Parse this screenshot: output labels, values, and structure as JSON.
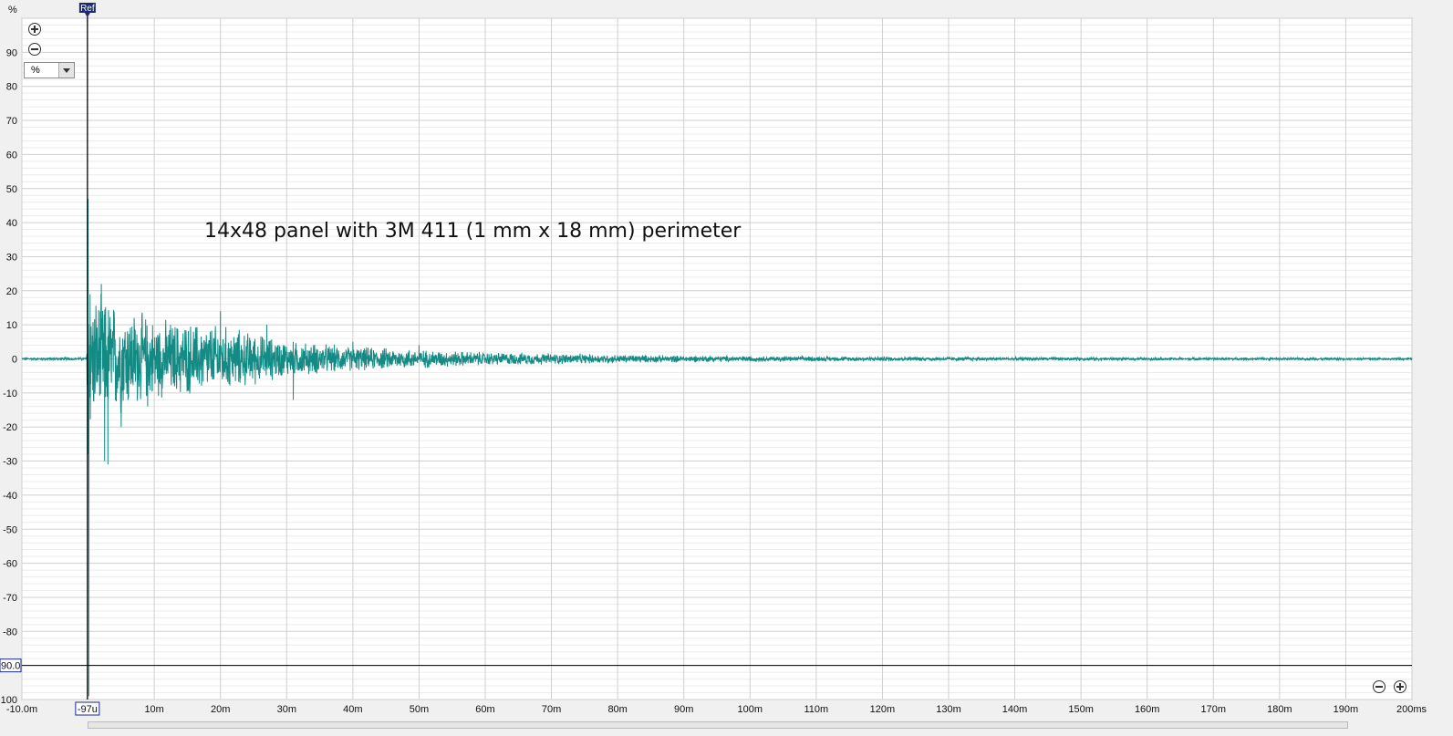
{
  "chart_data": {
    "type": "line",
    "y_unit_label": "%",
    "x_unit": "s",
    "xlim": [
      -0.01,
      0.2
    ],
    "ylim": [
      -100,
      100
    ],
    "x_tick_labels": [
      "-10.0m",
      "10m",
      "20m",
      "30m",
      "40m",
      "50m",
      "60m",
      "70m",
      "80m",
      "90m",
      "100m",
      "110m",
      "120m",
      "130m",
      "140m",
      "150m",
      "160m",
      "170m",
      "180m",
      "190m",
      "200ms"
    ],
    "x_tick_values": [
      -0.01,
      0.01,
      0.02,
      0.03,
      0.04,
      0.05,
      0.06,
      0.07,
      0.08,
      0.09,
      0.1,
      0.11,
      0.12,
      0.13,
      0.14,
      0.15,
      0.16,
      0.17,
      0.18,
      0.19,
      0.2
    ],
    "y_tick_values": [
      90,
      80,
      70,
      60,
      50,
      40,
      30,
      20,
      10,
      0,
      -10,
      -20,
      -30,
      -40,
      -50,
      -60,
      -70,
      -80,
      -100
    ],
    "annotation": "14x48 panel with 3M 411 (1 mm x 18 mm) perimeter",
    "reference_marker": {
      "label": "Ref",
      "x": -9.7e-05,
      "x_label": "-97u"
    },
    "level_marker": {
      "y": -90,
      "label": "90.0"
    },
    "grid": true,
    "series": [
      {
        "color": "#148a84",
        "envelope_x": [
          -0.01,
          -0.0002,
          0,
          0.0002,
          0.0005,
          0.002,
          0.005,
          0.01,
          0.02,
          0.03,
          0.04,
          0.05,
          0.06,
          0.07,
          0.08,
          0.09,
          0.1,
          0.12,
          0.14,
          0.16,
          0.18,
          0.2
        ],
        "envelope_y": [
          0.4,
          0.5,
          47,
          -28,
          20,
          20,
          18,
          13,
          11,
          6,
          4,
          3,
          2.2,
          1.8,
          1.4,
          1.1,
          0.9,
          0.7,
          0.55,
          0.45,
          0.4,
          0.35
        ],
        "peaks": [
          [
            0,
            47
          ],
          [
            3e-05,
            -28
          ],
          [
            0.0001,
            -99
          ],
          [
            0.0003,
            19
          ],
          [
            0.002,
            22
          ],
          [
            0.0025,
            -30
          ],
          [
            0.003,
            -31
          ],
          [
            0.005,
            -20
          ],
          [
            0.009,
            -14
          ],
          [
            0.02,
            14
          ],
          [
            0.027,
            10
          ],
          [
            0.031,
            -12
          ],
          [
            0.04,
            5
          ],
          [
            0.05,
            4
          ]
        ]
      }
    ]
  },
  "controls": {
    "y_zoom_in": "zoom-in",
    "y_zoom_out": "zoom-out",
    "x_zoom_in": "zoom-in",
    "x_zoom_out": "zoom-out",
    "unit_select_value": "%"
  }
}
